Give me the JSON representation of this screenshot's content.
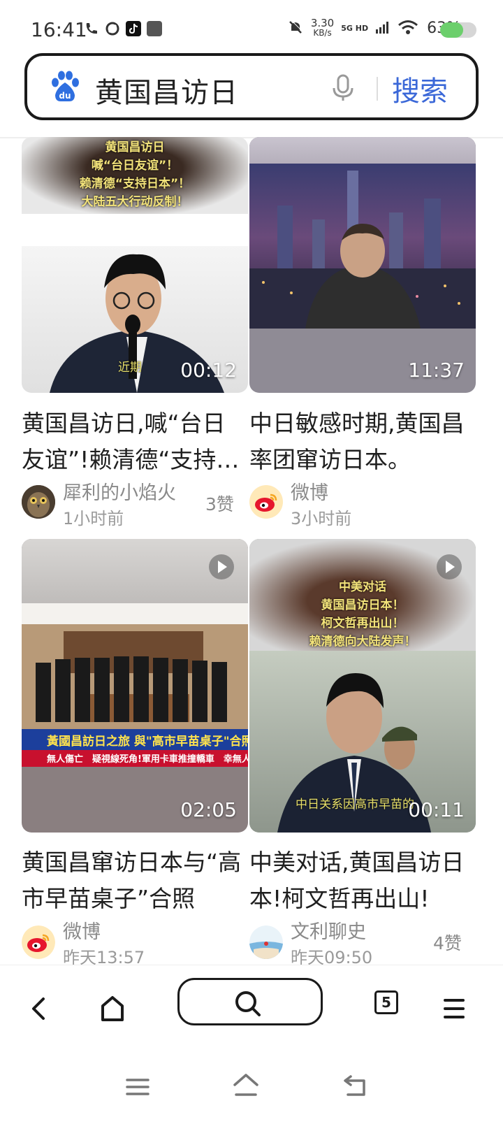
{
  "status_bar": {
    "time": "16:41",
    "net_speed_value": "3.30",
    "net_speed_unit": "KB/s",
    "network_label": "5G HD",
    "battery_percent": "63%",
    "battery_level": 0.63
  },
  "search": {
    "query": "黄国昌访日",
    "button_label": "搜索"
  },
  "cards": [
    {
      "title": "黄国昌访日,喊“台日友谊”!赖清德“支持日本”!大陆五大行动反制!",
      "duration": "00:12",
      "overlay_lines": [
        "黄国昌访日",
        "喊“台日友谊”！",
        "赖清德“支持日本”！",
        "大陆五大行动反制！"
      ],
      "subtitle": "近期",
      "author": "犀利的小焰火",
      "time": "1小时前",
      "likes": "3赞"
    },
    {
      "title": "中日敏感时期,黄国昌率团窜访日本。",
      "duration": "11:37",
      "author": "微博",
      "time": "3小时前",
      "likes": ""
    },
    {
      "title": "黄国昌窜访日本与“高市早苗桌子”合照",
      "duration": "02:05",
      "news_ticker": "黃國昌訪日之旅 與\"高市早苗桌子\"合照",
      "news_sub": "無人傷亡　疑視線死角!軍用卡車推撞轎車　幸無人",
      "author": "微博",
      "time": "昨天13:57",
      "likes": ""
    },
    {
      "title": "中美对话,黄国昌访日本!柯文哲再出山!",
      "duration": "00:11",
      "overlay_lines": [
        "中美对话",
        "黄国昌访日本！",
        "柯文哲再出山！",
        "赖清德向大陆发声！"
      ],
      "subtitle": "中日关系因高市早苗的",
      "author": "文利聊史",
      "time": "昨天09:50",
      "likes": "4赞"
    }
  ],
  "bottom_nav": {
    "tabs_count": "5"
  },
  "colors": {
    "accent": "#3b68d8",
    "baidu_blue": "#2f6fe0",
    "weibo_red": "#e6162d"
  }
}
